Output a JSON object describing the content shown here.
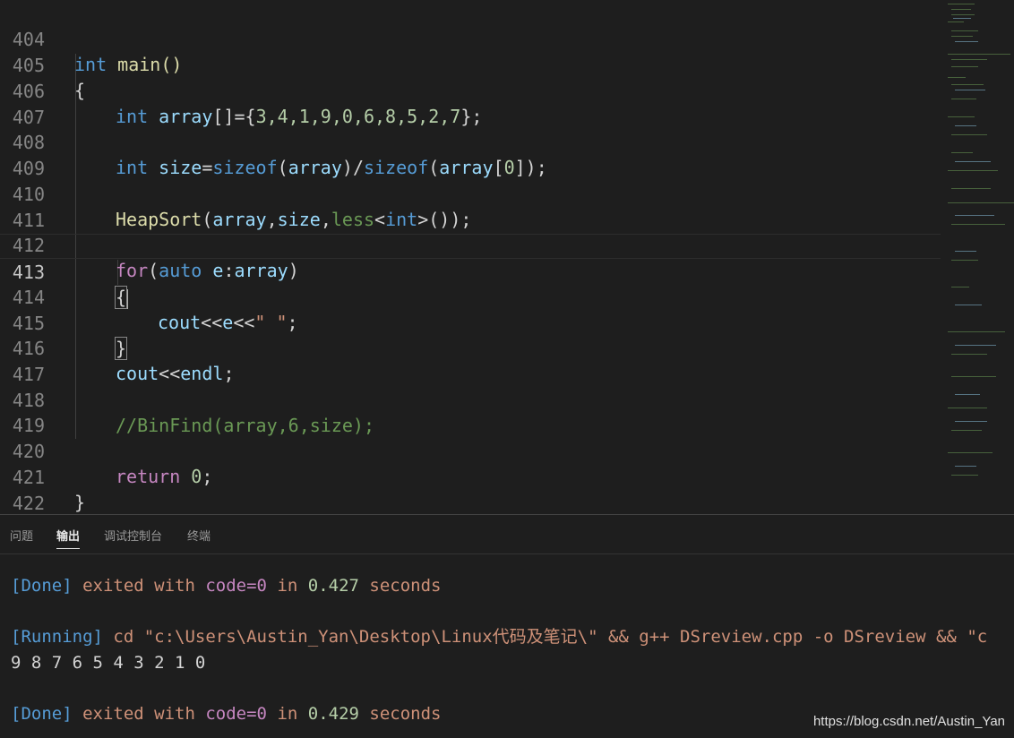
{
  "editor": {
    "line_numbers": [
      "404",
      "405",
      "406",
      "407",
      "408",
      "409",
      "410",
      "411",
      "412",
      "413",
      "414",
      "415",
      "416",
      "417",
      "418",
      "419",
      "420",
      "421",
      "422"
    ],
    "active_line": "413",
    "code": {
      "l404": {
        "kw": "int",
        "rest": " main()"
      },
      "l405": {
        "text": "{"
      },
      "l406": {
        "kw": "int",
        "var": "array",
        "pre": "[]={",
        "nums": "3,4,1,9,0,6,8,5,2,7",
        "post": "};"
      },
      "l408": {
        "kw": "int",
        "var": "size",
        "eq": "=",
        "fn1": "sizeof",
        "arg1": "array",
        "div": ")/",
        "fn2": "sizeof",
        "arg2": "array",
        "idx_open": "[",
        "idx": "0",
        "idx_close": "]);"
      },
      "l410": {
        "fn": "HeapSort",
        "p1": "(",
        "a1": "array",
        "c1": ",",
        "a2": "size",
        "c2": ",",
        "a3": "less",
        "lt": "<",
        "kw": "int",
        "gt": ">());"
      },
      "l412": {
        "ctl": "for",
        "p1": "(",
        "kw": "auto",
        "var": " e",
        "colon": ":",
        "arr": "array",
        "p2": ")"
      },
      "l413": {
        "text": "{"
      },
      "l414": {
        "var1": "cout",
        "op": "<<",
        "var2": "e",
        "op2": "<<",
        "str": "\" \"",
        "end": ";"
      },
      "l415": {
        "text": "}"
      },
      "l416": {
        "var1": "cout",
        "op": "<<",
        "var2": "endl",
        "end": ";"
      },
      "l418": {
        "comment": "//BinFind(array,6,size);"
      },
      "l420": {
        "ctl": "return",
        "num": "0",
        "end": ";"
      },
      "l421": {
        "text": "}"
      }
    }
  },
  "panel": {
    "tabs": [
      "问题",
      "输出",
      "调试控制台",
      "终端"
    ],
    "active_tab": "输出",
    "output": {
      "line1": {
        "tag": "[Done]",
        "a": " exited with ",
        "code": "code=0",
        "b": " in ",
        "num": "0.427",
        "c": " seconds"
      },
      "line2": {
        "tag": "[Running]",
        "cmd": " cd \"c:\\Users\\Austin_Yan\\Desktop\\Linux代码及笔记\\\" && g++ DSreview.cpp -o DSreview && \"c"
      },
      "line3": {
        "text": "9 8 7 6 5 4 3 2 1 0"
      },
      "line4": {
        "tag": "[Done]",
        "a": " exited with ",
        "code": "code=0",
        "b": " in ",
        "num": "0.429",
        "c": " seconds"
      }
    }
  },
  "watermark": "https://blog.csdn.net/Austin_Yan",
  "colors": {
    "background": "#1e1e1e",
    "keyword": "#569cd6",
    "function": "#dcdcaa",
    "variable": "#9cdcfe",
    "number": "#b5cea8",
    "string": "#ce9178",
    "control": "#c586c0",
    "comment": "#6a9955"
  }
}
